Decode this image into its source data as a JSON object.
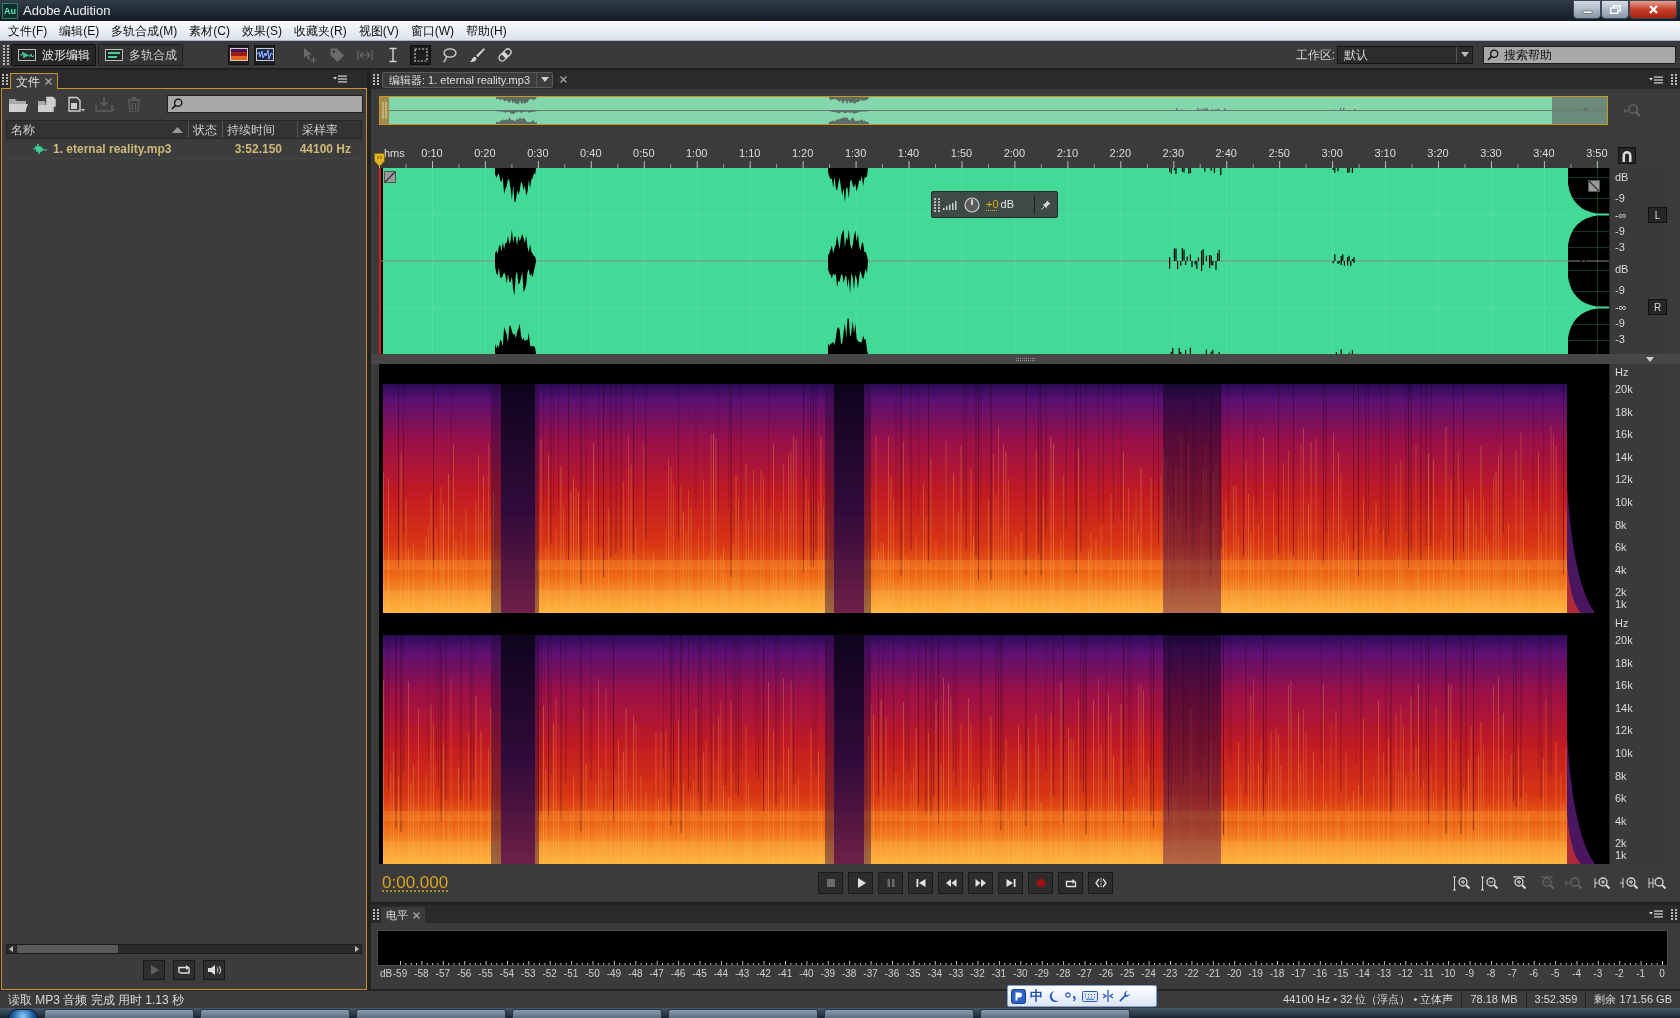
{
  "window": {
    "app_icon": "Au",
    "title": "Adobe Audition"
  },
  "menu": [
    "文件(F)",
    "编辑(E)",
    "多轨合成(M)",
    "素材(C)",
    "效果(S)",
    "收藏夹(R)",
    "视图(V)",
    "窗口(W)",
    "帮助(H)"
  ],
  "toolbar": {
    "modes": [
      {
        "kind": "waveform",
        "label": "波形编辑",
        "selected": true
      },
      {
        "kind": "multitrack",
        "label": "多轨合成",
        "selected": false
      }
    ],
    "views": [
      {
        "kind": "spectral"
      },
      {
        "kind": "waveform"
      }
    ],
    "tools": [
      {
        "kind": "move",
        "disabled": true,
        "selected": false
      },
      {
        "kind": "slip",
        "disabled": true,
        "selected": false
      },
      {
        "kind": "stretch",
        "disabled": true,
        "selected": false
      },
      {
        "kind": "time-select",
        "disabled": false,
        "selected": false
      },
      {
        "kind": "marquee",
        "disabled": false,
        "selected": true
      },
      {
        "kind": "lasso",
        "disabled": false,
        "selected": false
      },
      {
        "kind": "brush",
        "disabled": false,
        "selected": false
      },
      {
        "kind": "heal",
        "disabled": false,
        "selected": false
      }
    ],
    "workspace": {
      "label": "工作区:",
      "value": "默认"
    },
    "help_search": {
      "placeholder": "搜索帮助"
    }
  },
  "files_panel": {
    "tab": "文件",
    "tools": [
      {
        "kind": "open",
        "disabled": false
      },
      {
        "kind": "import",
        "disabled": false
      },
      {
        "kind": "new",
        "disabled": false
      },
      {
        "kind": "insert",
        "disabled": true
      },
      {
        "kind": "delete",
        "disabled": true
      }
    ],
    "columns": [
      {
        "label": "名称",
        "sorted": true
      },
      {
        "label": "状态",
        "sorted": false
      },
      {
        "label": "持续时间",
        "sorted": false
      },
      {
        "label": "采样率",
        "sorted": false
      }
    ],
    "rows": [
      {
        "name": "1. eternal reality.mp3",
        "duration": "3:52.150",
        "sample_rate": "44100 Hz",
        "selected": false
      }
    ],
    "preview": [
      {
        "kind": "play",
        "disabled": true
      },
      {
        "kind": "loop",
        "disabled": false
      },
      {
        "kind": "autoplay",
        "disabled": false
      }
    ]
  },
  "editor": {
    "tab": "编辑器: 1. eternal reality.mp3",
    "ruler": {
      "unit": "hms",
      "ticks": [
        "0:10",
        "0:20",
        "0:30",
        "0:40",
        "0:50",
        "1:00",
        "1:10",
        "1:20",
        "1:30",
        "1:40",
        "1:50",
        "2:00",
        "2:10",
        "2:20",
        "2:30",
        "2:40",
        "2:50",
        "3:00",
        "3:10",
        "3:20",
        "3:30",
        "3:40",
        "3:50"
      ]
    },
    "channels": [
      {
        "label": "L",
        "scale": [
          "dB",
          "-9",
          "-∞",
          "-9",
          "-3"
        ]
      },
      {
        "label": "R",
        "scale": [
          "dB",
          "-9",
          "-∞",
          "-9",
          "-3"
        ]
      }
    ],
    "hud": {
      "gain": "+0",
      "unit": "dB"
    },
    "spectrogram": [
      {
        "scale": [
          "Hz",
          "20k",
          "18k",
          "16k",
          "14k",
          "12k",
          "10k",
          "8k",
          "6k",
          "4k",
          "2k",
          "1k"
        ]
      },
      {
        "scale": [
          "Hz",
          "20k",
          "18k",
          "16k",
          "14k",
          "12k",
          "10k",
          "8k",
          "6k",
          "4k",
          "2k",
          "1k"
        ]
      }
    ],
    "time": "0:00.000",
    "transport": [
      {
        "kind": "stop",
        "disabled": true
      },
      {
        "kind": "play",
        "disabled": false
      },
      {
        "kind": "pause",
        "disabled": true
      },
      {
        "kind": "to-start",
        "disabled": false
      },
      {
        "kind": "rewind",
        "disabled": false
      },
      {
        "kind": "fast-forward",
        "disabled": false
      },
      {
        "kind": "to-end",
        "disabled": false
      },
      {
        "kind": "record",
        "disabled": false
      },
      {
        "kind": "loop",
        "disabled": false
      },
      {
        "kind": "skip-selection",
        "disabled": false
      }
    ],
    "zoom": [
      {
        "kind": "amp-in",
        "disabled": false
      },
      {
        "kind": "amp-out",
        "disabled": false
      },
      {
        "kind": "in",
        "disabled": false
      },
      {
        "kind": "out",
        "disabled": true
      },
      {
        "kind": "full",
        "disabled": true
      },
      {
        "kind": "in-start",
        "disabled": false
      },
      {
        "kind": "in-end",
        "disabled": false
      },
      {
        "kind": "selection",
        "disabled": false
      }
    ]
  },
  "levels_panel": {
    "tab": "电平",
    "scale": [
      "dB",
      "-59",
      "-58",
      "-57",
      "-56",
      "-55",
      "-54",
      "-53",
      "-52",
      "-51",
      "-50",
      "-49",
      "-48",
      "-47",
      "-46",
      "-45",
      "-44",
      "-43",
      "-42",
      "-41",
      "-40",
      "-39",
      "-38",
      "-37",
      "-36",
      "-35",
      "-34",
      "-33",
      "-32",
      "-31",
      "-30",
      "-29",
      "-28",
      "-27",
      "-26",
      "-25",
      "-24",
      "-23",
      "-22",
      "-21",
      "-20",
      "-19",
      "-18",
      "-17",
      "-16",
      "-15",
      "-14",
      "-13",
      "-12",
      "-11",
      "-10",
      "-9",
      "-8",
      "-7",
      "-6",
      "-5",
      "-4",
      "-3",
      "-2",
      "-1",
      "0"
    ]
  },
  "status_bar": {
    "message": "读取 MP3 音频 完成 用时 1.13 秒",
    "info": [
      "44100 Hz • 32 位（浮点） • 立体声",
      "78.18 MB",
      "3:52.359",
      "剩余 171.56 GB"
    ]
  },
  "ime_bar": {
    "mode": "中"
  }
}
